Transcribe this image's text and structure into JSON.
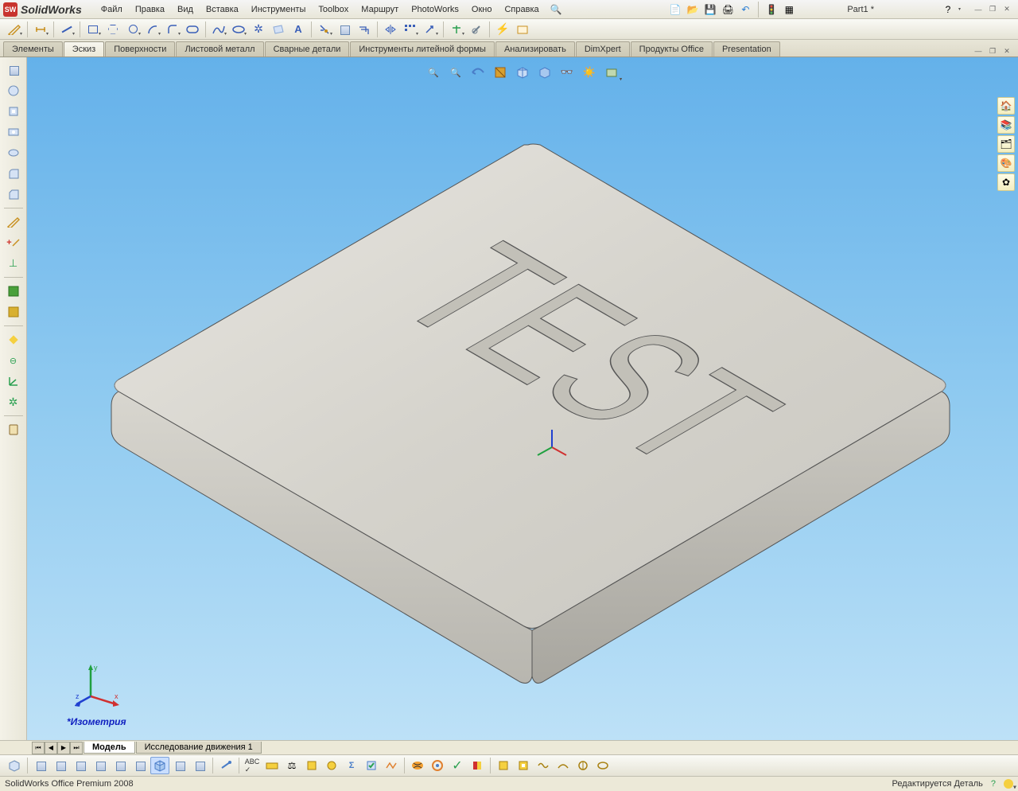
{
  "app": {
    "name": "SolidWorks"
  },
  "document": {
    "name": "Part1 *"
  },
  "menu": [
    "Файл",
    "Правка",
    "Вид",
    "Вставка",
    "Инструменты",
    "Toolbox",
    "Маршрут",
    "PhotoWorks",
    "Окно",
    "Справка"
  ],
  "cmd_tabs": [
    "Элементы",
    "Эскиз",
    "Поверхности",
    "Листовой металл",
    "Сварные детали",
    "Инструменты литейной формы",
    "Анализировать",
    "DimXpert",
    "Продукты Office",
    "Presentation"
  ],
  "cmd_tab_active": 1,
  "viewport": {
    "orientation_label": "*Изометрия",
    "model_text": "TEST",
    "triad": {
      "x": "x",
      "y": "y",
      "z": "z"
    }
  },
  "bottom_tabs": {
    "items": [
      "Модель",
      "Исследование движения 1"
    ],
    "active": 0
  },
  "statusbar": {
    "left": "SolidWorks Office Premium 2008",
    "right": "Редактируется Деталь"
  },
  "help_glyph": "?",
  "colors": {
    "viewport_top": "#64b1ea",
    "accent": "#3a5fb8"
  }
}
